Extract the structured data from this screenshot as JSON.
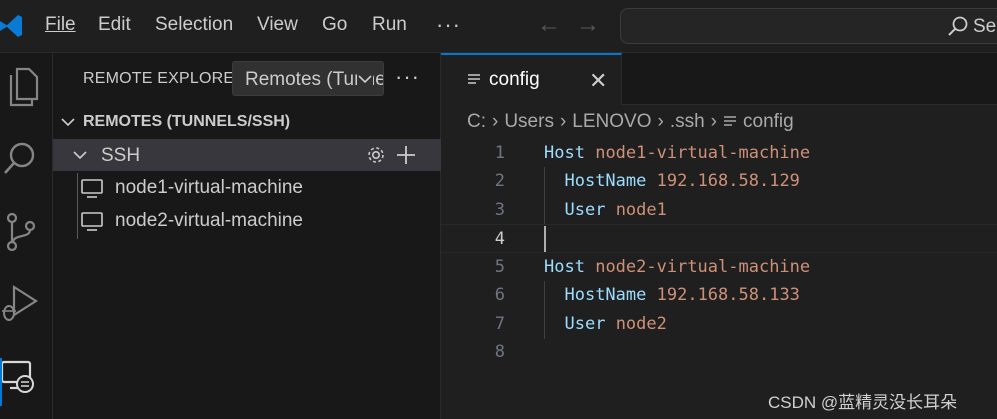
{
  "menubar": {
    "items": [
      {
        "label": "File"
      },
      {
        "label": "Edit"
      },
      {
        "label": "Selection"
      },
      {
        "label": "View"
      },
      {
        "label": "Go"
      },
      {
        "label": "Run"
      }
    ],
    "more": "···",
    "search_text": "Sea"
  },
  "sidebar": {
    "title": "REMOTE EXPLORER",
    "remotes_dropdown": "Remotes (Tunnels/SSH)",
    "more": "···",
    "section_title": "REMOTES (TUNNELS/SSH)",
    "group_label": "SSH",
    "hosts": [
      {
        "label": "node1-virtual-machine"
      },
      {
        "label": "node2-virtual-machine"
      }
    ]
  },
  "editor": {
    "tab": {
      "label": "config",
      "close": "✕"
    },
    "breadcrumb": [
      "C:",
      "Users",
      "LENOVO",
      ".ssh",
      "config"
    ],
    "lines": [
      {
        "n": "1",
        "key": "Host",
        "value": "node1-virtual-machine"
      },
      {
        "n": "2",
        "key": "HostName",
        "value": "192.168.58.129"
      },
      {
        "n": "3",
        "key": "User",
        "value": "node1"
      },
      {
        "n": "4",
        "key": "",
        "value": ""
      },
      {
        "n": "5",
        "key": "Host",
        "value": "node2-virtual-machine"
      },
      {
        "n": "6",
        "key": "HostName",
        "value": "192.168.58.133"
      },
      {
        "n": "7",
        "key": "User",
        "value": "node2"
      },
      {
        "n": "8",
        "key": "",
        "value": ""
      }
    ]
  },
  "watermark": "CSDN @蓝精灵没长耳朵",
  "colors": {
    "accent": "#0078d4",
    "keyword": "#9cdcfe",
    "string": "#ce9178",
    "logo": "#0a7bd4"
  }
}
